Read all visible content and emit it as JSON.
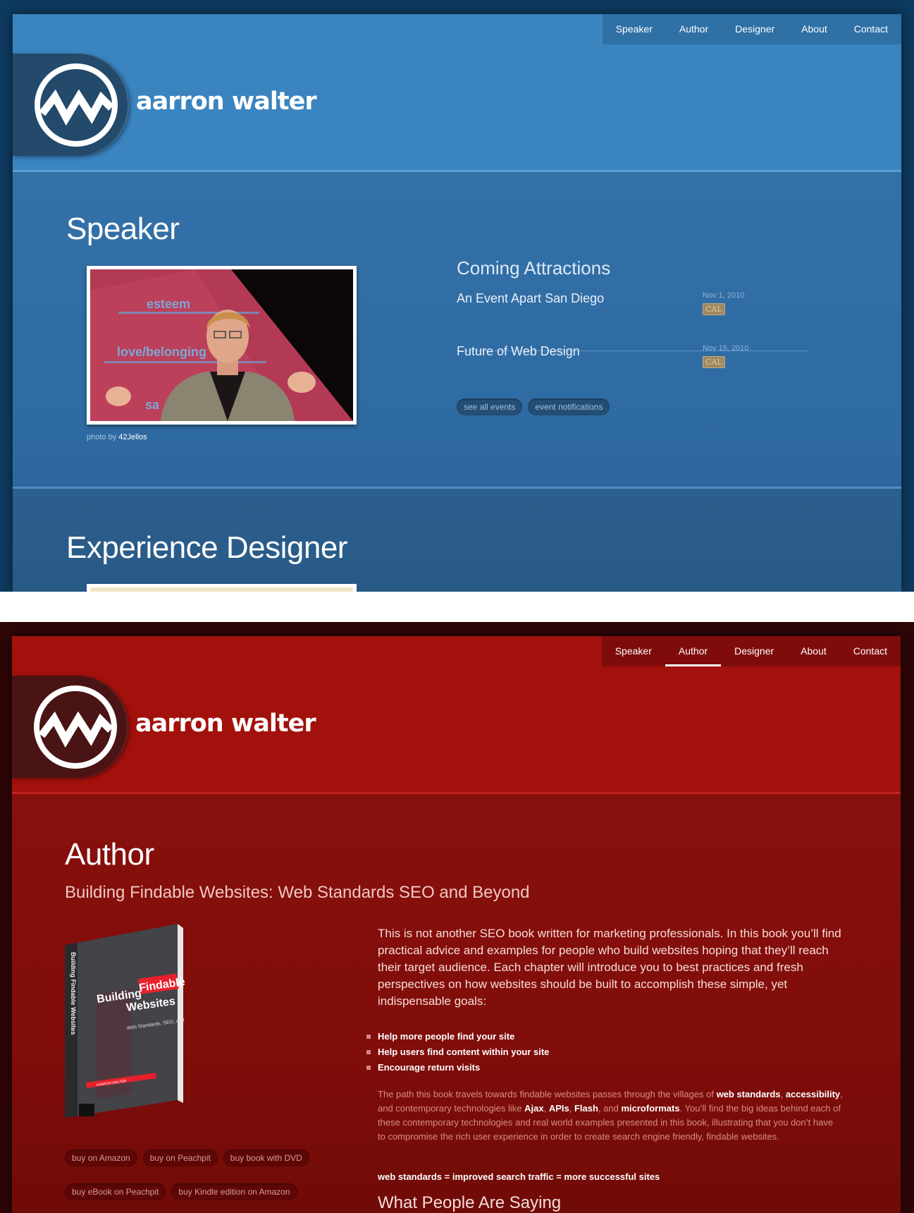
{
  "site": {
    "name": "aarron walter"
  },
  "nav": [
    "Speaker",
    "Author",
    "Designer",
    "About",
    "Contact"
  ],
  "speaker": {
    "title": "Speaker",
    "photo_credit_prefix": "photo by",
    "photo_credit_link": "42Jellos",
    "photo_words": [
      "esteem",
      "love/belonging",
      "sa"
    ],
    "attractions_title": "Coming Attractions",
    "events": [
      {
        "name": "An Event Apart San Diego",
        "date": "Nov 1, 2010",
        "badge": "CAL"
      },
      {
        "name": "Future of Web Design",
        "date": "Nov 15, 2010",
        "badge": "CAL"
      }
    ],
    "buttons": [
      "see all events",
      "event notifications"
    ],
    "next_section_title": "Experience Designer"
  },
  "author": {
    "title": "Author",
    "book_title": "Building Findable Websites: Web Standards SEO and Beyond",
    "cover": {
      "spine": "Building Findable Websites",
      "line1": "Building",
      "line1_highlight": "Findable",
      "line2": "Websites",
      "sub": "Web Standards, SEO, and Beyond",
      "author": "AARRON WALTER"
    },
    "intro": "This is not another SEO book written for marketing professionals. In this book you’ll find practical advice and examples for people who build websites hoping that they’ll reach their target audience. Each chapter will introduce you to best practices and fresh perspectives on how websites should be built to accomplish these simple, yet indispensable goals:",
    "bullets": [
      "Help more people find your site",
      "Help users find content within your site",
      "Encourage return visits"
    ],
    "para": {
      "t1": "The path this book travels towards findable websites passes through the villages of ",
      "b1": "web standards",
      "t2": ", ",
      "b2": "accessibility",
      "t3": ", and contemporary technologies like ",
      "b3": "Ajax",
      "t4": ", ",
      "b4": "APIs",
      "t5": ", ",
      "b5": "Flash",
      "t6": ", and ",
      "b6": "microformats",
      "t7": ". You’ll find the big ideas behind each of these contemporary technologies and real world examples presented in this book, illustrating that you don’t have to compromise the rich user experience in order to create search engine friendly, findable websites."
    },
    "formula": "web standards = improved search traffic = more successful sites",
    "saying_title": "What People Are Saying",
    "buy_buttons_row1": [
      "buy on Amazon",
      "buy on Peachpit",
      "buy book with DVD"
    ],
    "buy_buttons_row2": [
      "buy eBook on Peachpit",
      "buy Kindle edition on Amazon"
    ]
  }
}
